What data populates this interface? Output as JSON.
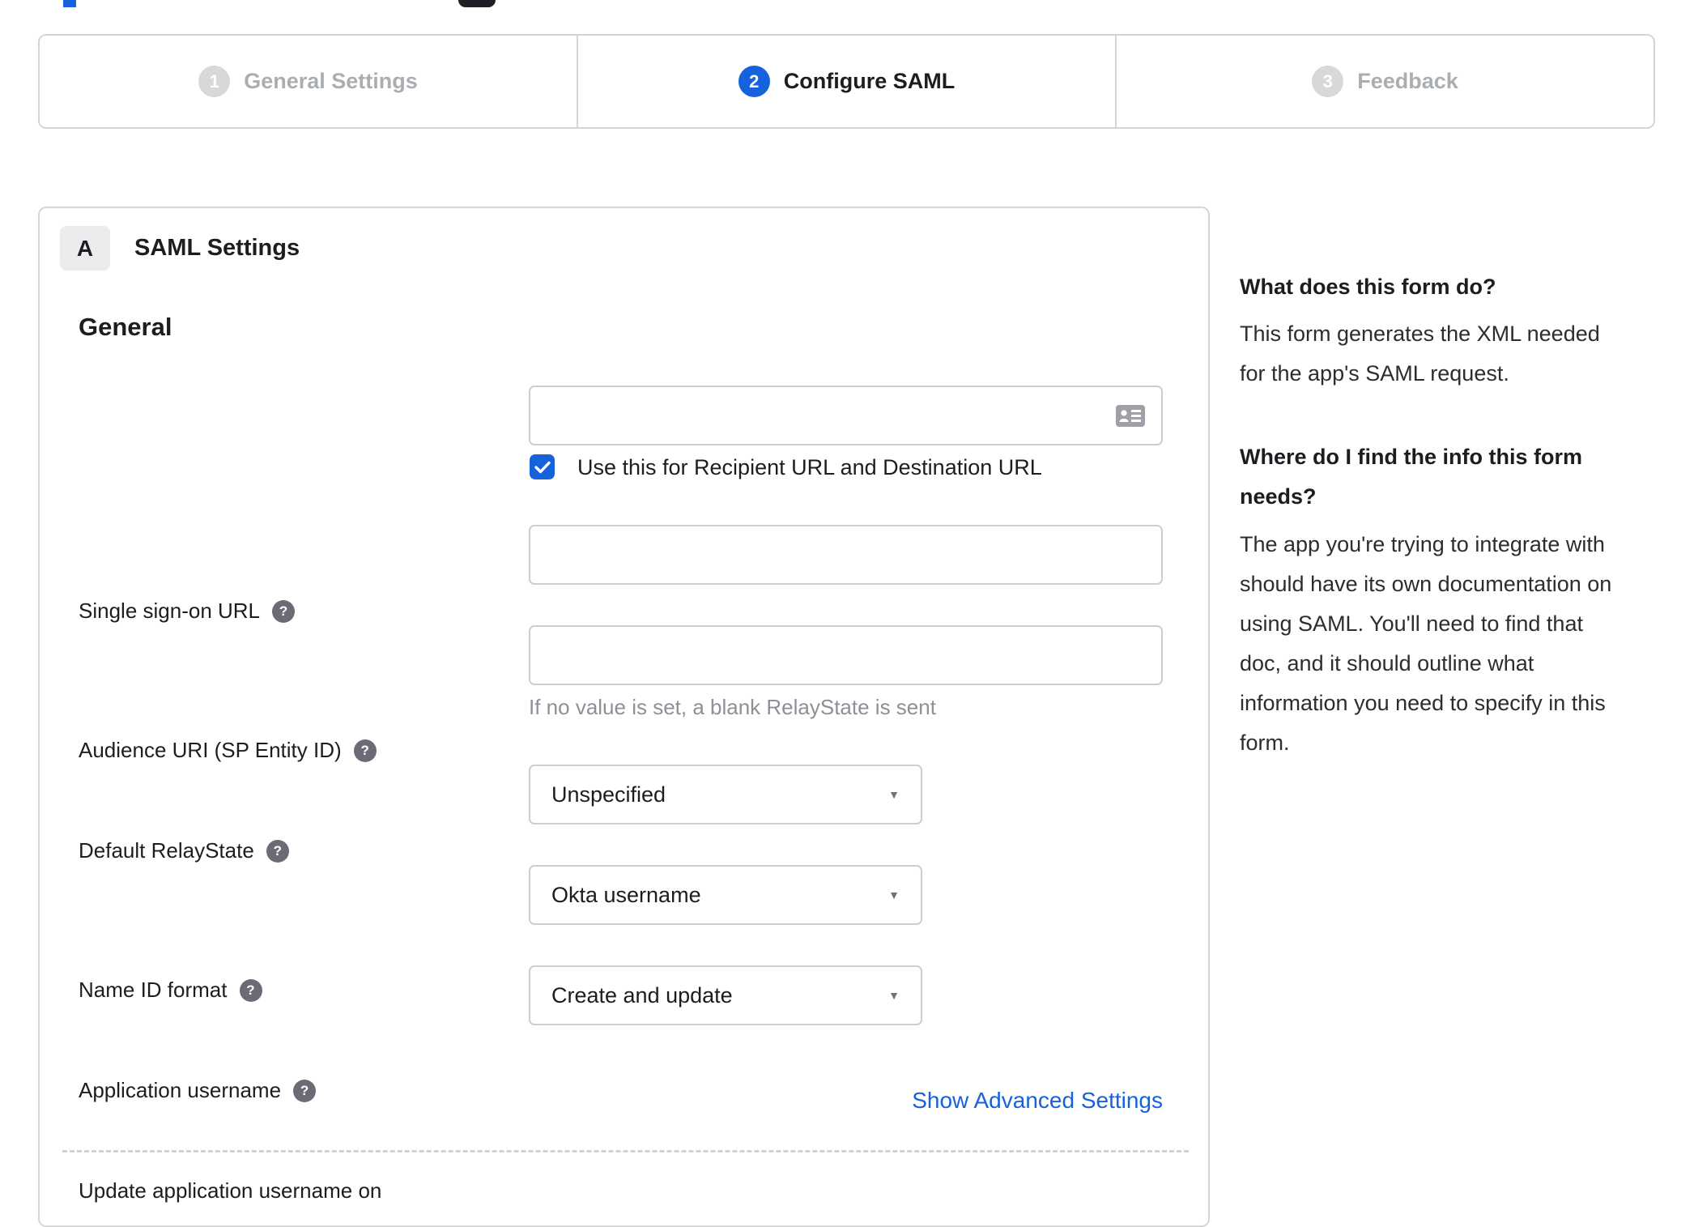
{
  "colors": {
    "accent_blue": "#1662dd",
    "inactive_gray": "#d6d8da",
    "border_gray": "#d6d6da",
    "text_dark": "#1d1d21",
    "hint_gray": "#8f8f97"
  },
  "icons": {
    "help_glyph": "?",
    "caret_glyph": "▼"
  },
  "stepper": {
    "steps": [
      {
        "number": "1",
        "label": "General Settings",
        "state": "inactive"
      },
      {
        "number": "2",
        "label": "Configure SAML",
        "state": "active"
      },
      {
        "number": "3",
        "label": "Feedback",
        "state": "inactive"
      }
    ]
  },
  "panel": {
    "section_badge": "A",
    "section_title": "SAML Settings",
    "group_title": "General",
    "fields": {
      "sso": {
        "label": "Single sign-on URL",
        "value": "",
        "checkbox_label": "Use this for Recipient URL and Destination URL",
        "checkbox_checked": true
      },
      "audience": {
        "label": "Audience URI (SP Entity ID)",
        "value": ""
      },
      "relay": {
        "label": "Default RelayState",
        "value": "",
        "hint": "If no value is set, a blank RelayState is sent"
      },
      "nameid": {
        "label": "Name ID format",
        "value": "Unspecified"
      },
      "appuser": {
        "label": "Application username",
        "value": "Okta username"
      },
      "updateuser": {
        "label": "Update application username on",
        "value": "Create and update"
      }
    },
    "advanced_link": "Show Advanced Settings"
  },
  "sidebar": {
    "heading1": "What does this form do?",
    "para1": "This form generates the XML needed\nfor the app's SAML request.",
    "heading2": "Where do I find the info this form\nneeds?",
    "para2": "The app you're trying to integrate with\nshould have its own documentation on\nusing SAML. You'll need to find that\ndoc, and it should outline what\ninformation you need to specify in this\nform."
  }
}
